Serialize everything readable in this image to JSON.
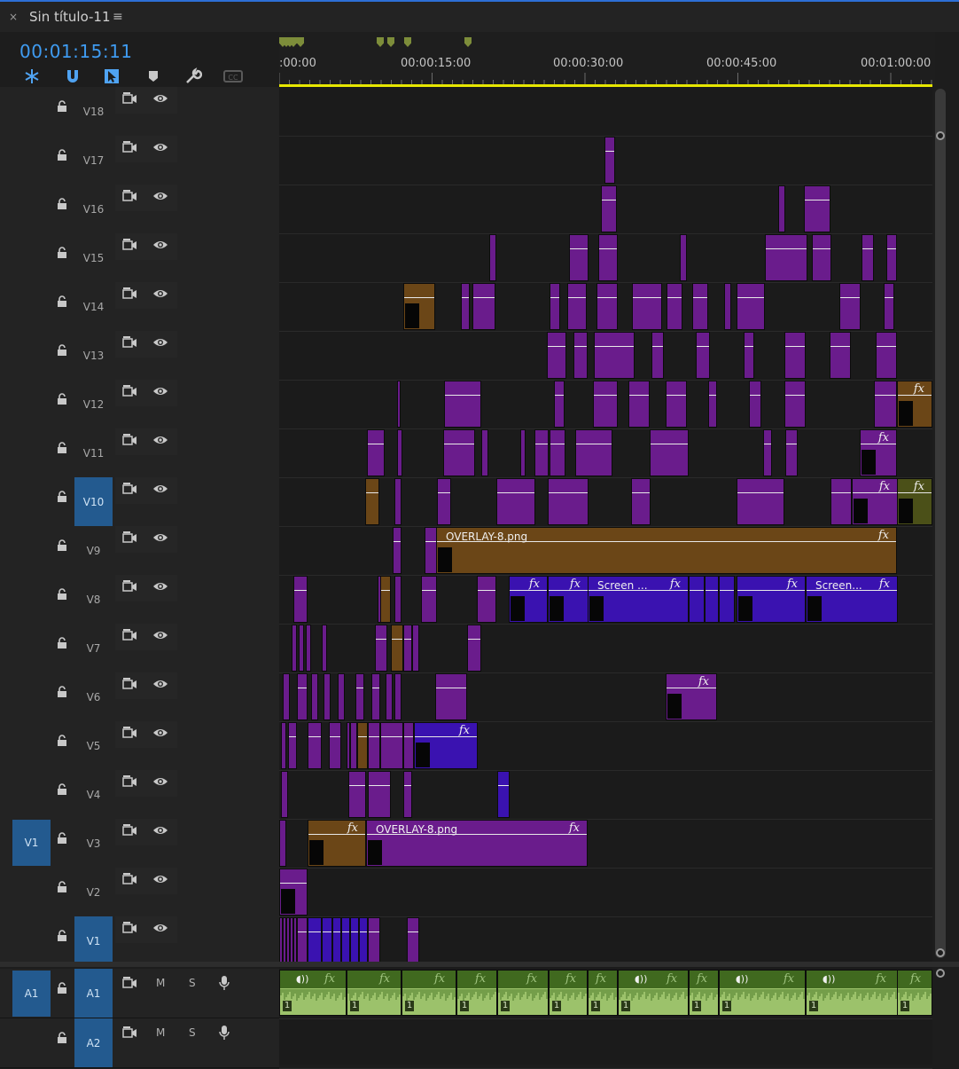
{
  "panel": {
    "close_glyph": "×",
    "title": "Sin título-11",
    "menu_glyph": "≡",
    "timecode": "00:01:15:11"
  },
  "toolbar": [
    "snap-icon",
    "magnet-icon",
    "linked-selection-icon",
    "marker-icon",
    "wrench-icon",
    "captions-icon"
  ],
  "ruler": {
    "labels": [
      ":00:00",
      "00:00:15:00",
      "00:00:30:00",
      "00:00:45:00",
      "00:01:00:00"
    ]
  },
  "video_tracks": [
    "V18",
    "V17",
    "V16",
    "V15",
    "V14",
    "V13",
    "V12",
    "V11",
    "V10",
    "V9",
    "V8",
    "V7",
    "V6",
    "V5",
    "V4",
    "V3",
    "V2",
    "V1"
  ],
  "active_tracks": [
    "V10",
    "V1"
  ],
  "source_patch": {
    "video": "V1",
    "audio": "A1"
  },
  "audio_tracks": [
    {
      "name": "A1",
      "m": "M",
      "s": "S"
    },
    {
      "name": "A2",
      "m": "M",
      "s": "S"
    }
  ],
  "clip_labels": {
    "overlay_v9": "OVERLAY-8.png",
    "overlay_v3": "OVERLAY-8.png",
    "screen_1": "Screen ...",
    "screen_2": "Screen..."
  },
  "fx_label": "fx",
  "audio_channel_label": "1",
  "colors": {
    "timecode": "#3f9bf0",
    "purple_clip": "#6a1c8c",
    "blue_clip": "#3a12b0",
    "brown_clip": "#6b4617",
    "olive_clip": "#4b5018",
    "audio_clip": "#9cc26b",
    "active_track": "#235a8f",
    "playhead_bar": "#e6e600"
  }
}
